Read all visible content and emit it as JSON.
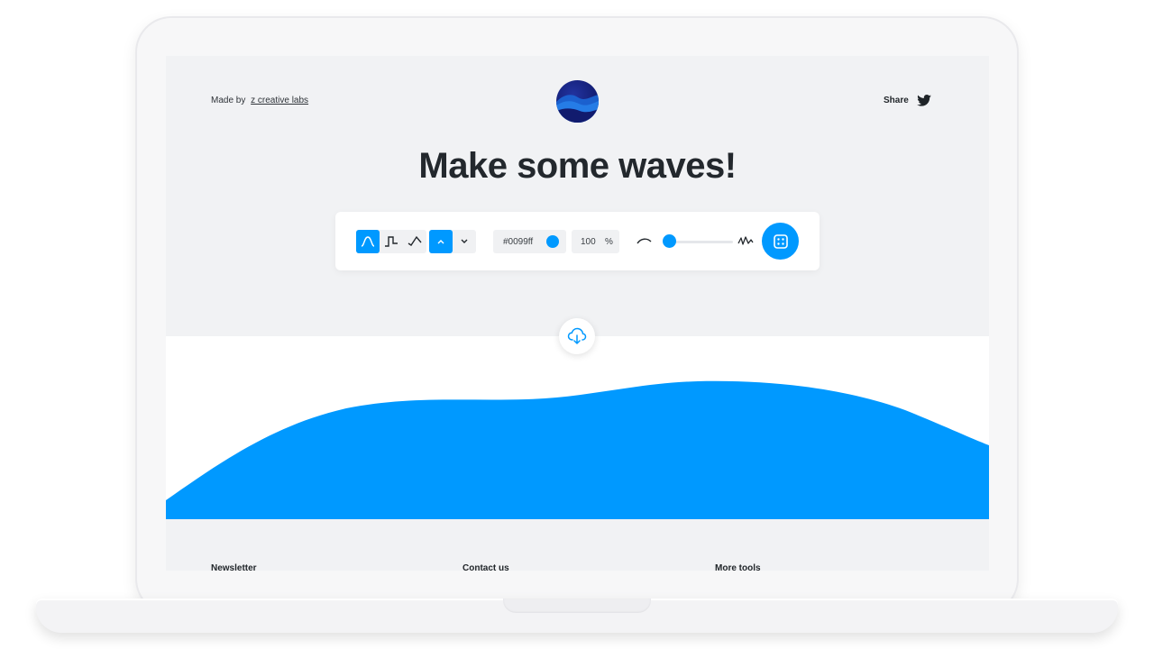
{
  "header": {
    "made_by_prefix": "Made by",
    "made_by_link": "z creative labs",
    "share_label": "Share"
  },
  "headline": "Make some waves!",
  "toolbar": {
    "wave_types": [
      "smooth-wave-icon",
      "square-wave-icon",
      "peak-wave-icon"
    ],
    "selected_wave_type": "smooth",
    "direction_options": [
      "up",
      "down"
    ],
    "selected_direction": "up",
    "color_value": "#0099ff",
    "opacity_value": "100",
    "opacity_unit": "%",
    "complexity_level": 0.05
  },
  "footer": {
    "columns": [
      "Newsletter",
      "Contact us",
      "More tools"
    ]
  },
  "colors": {
    "accent": "#0099ff",
    "screen_background": "#f1f2f4",
    "headline": "#23282d",
    "logo": "#111b6e"
  }
}
